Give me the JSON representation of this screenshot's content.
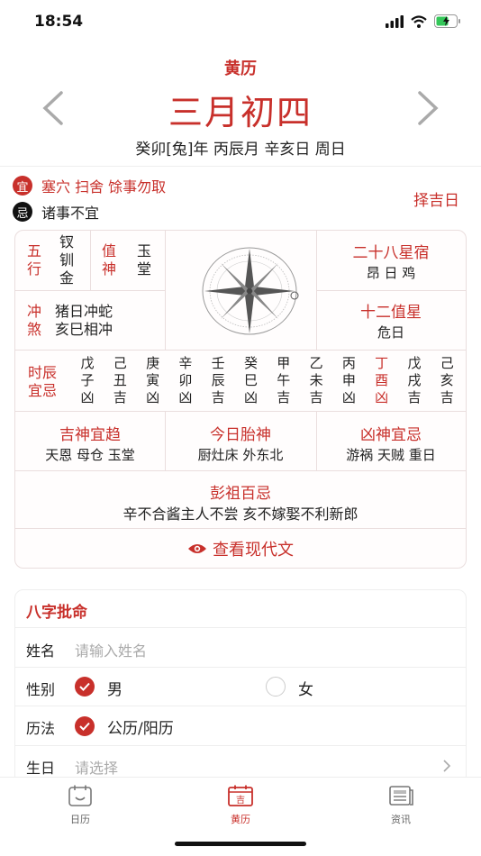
{
  "status": {
    "time": "18:54"
  },
  "header": {
    "title": "黄历",
    "lunar_date": "三月初四",
    "ganzhi": "癸卯[兔]年 丙辰月 辛亥日 周日"
  },
  "yiji": {
    "yi_badge": "宜",
    "yi_text": "塞穴 扫舍 馀事勿取",
    "ji_badge": "忌",
    "ji_text": "诸事不宜",
    "zeji_label": "择吉日"
  },
  "almanac": {
    "wuxing_label": [
      "五",
      "行"
    ],
    "wuxing_value": [
      "钗",
      "钏",
      "金"
    ],
    "zhishen_label": [
      "值",
      "神"
    ],
    "zhishen_value": [
      "玉",
      "堂"
    ],
    "xiu_title": "二十八星宿",
    "xiu_value": "昂 日 鸡",
    "chongsha_label": [
      "冲",
      "煞"
    ],
    "chongsha_value": [
      "猪日冲蛇",
      "亥巳相冲"
    ],
    "zhixing_title": "十二值星",
    "zhixing_value": "危日",
    "hours_label": [
      "时辰",
      "宜忌"
    ],
    "hours": [
      {
        "stem": "戊",
        "branch": "子",
        "luck": "凶",
        "highlight": false
      },
      {
        "stem": "己",
        "branch": "丑",
        "luck": "吉",
        "highlight": false
      },
      {
        "stem": "庚",
        "branch": "寅",
        "luck": "凶",
        "highlight": false
      },
      {
        "stem": "辛",
        "branch": "卯",
        "luck": "凶",
        "highlight": false
      },
      {
        "stem": "壬",
        "branch": "辰",
        "luck": "吉",
        "highlight": false
      },
      {
        "stem": "癸",
        "branch": "巳",
        "luck": "凶",
        "highlight": false
      },
      {
        "stem": "甲",
        "branch": "午",
        "luck": "吉",
        "highlight": false
      },
      {
        "stem": "乙",
        "branch": "未",
        "luck": "吉",
        "highlight": false
      },
      {
        "stem": "丙",
        "branch": "申",
        "luck": "凶",
        "highlight": false
      },
      {
        "stem": "丁",
        "branch": "酉",
        "luck": "凶",
        "highlight": true
      },
      {
        "stem": "戊",
        "branch": "戌",
        "luck": "吉",
        "highlight": false
      },
      {
        "stem": "己",
        "branch": "亥",
        "luck": "吉",
        "highlight": false
      }
    ],
    "jishen_title": "吉神宜趋",
    "jishen_value": "天恩 母仓 玉堂",
    "taishen_title": "今日胎神",
    "taishen_value": "厨灶床 外东北",
    "xiongshen_title": "凶神宜忌",
    "xiongshen_value": "游祸 天贼 重日",
    "pengzu_title": "彭祖百忌",
    "pengzu_value": "辛不合酱主人不尝 亥不嫁娶不利新郎",
    "view_modern": "查看现代文"
  },
  "bazi": {
    "title": "八字批命",
    "name_label": "姓名",
    "name_placeholder": "请输入姓名",
    "gender_label": "性别",
    "gender_male": "男",
    "gender_female": "女",
    "calendar_label": "历法",
    "calendar_value": "公历/阳历",
    "birthday_label": "生日",
    "birthday_placeholder": "请选择"
  },
  "tabs": [
    {
      "label": "日历",
      "icon": "calendar-icon",
      "active": false
    },
    {
      "label": "黄历",
      "icon": "almanac-icon",
      "active": true
    },
    {
      "label": "资讯",
      "icon": "news-icon",
      "active": false
    }
  ],
  "colors": {
    "accent": "#c8302b"
  }
}
